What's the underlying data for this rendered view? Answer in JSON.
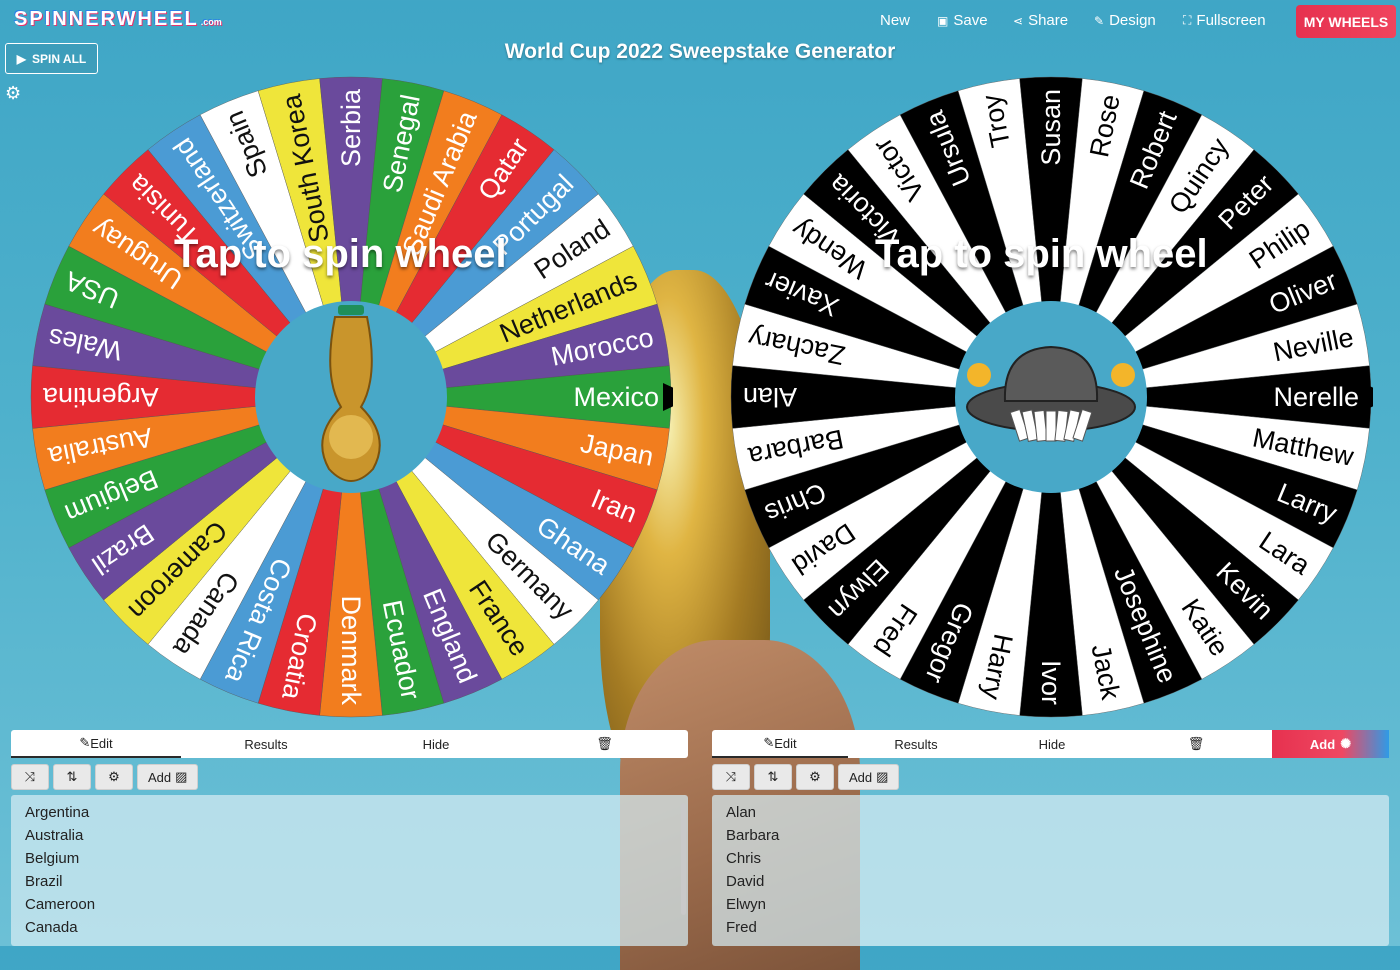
{
  "header": {
    "logo": "SPINNERWHEEL",
    "logo_suffix": ".com",
    "nav": [
      {
        "label": "New",
        "icon": ""
      },
      {
        "label": "Save",
        "icon": "save-icon"
      },
      {
        "label": "Share",
        "icon": "share-icon"
      },
      {
        "label": "Design",
        "icon": "pencil-icon"
      },
      {
        "label": "Fullscreen",
        "icon": "fullscreen-icon"
      }
    ],
    "my_wheels": "MY WHEELS",
    "title": "World Cup 2022 Sweepstake Generator",
    "spin_all": "SPIN ALL"
  },
  "wheels": [
    {
      "tap_text": "Tap to spin wheel",
      "center": "trophy-image",
      "segments": [
        {
          "label": "Mexico",
          "color": "#2aa13b"
        },
        {
          "label": "Japan",
          "color": "#f27d1e"
        },
        {
          "label": "Iran",
          "color": "#e52b32"
        },
        {
          "label": "Ghana",
          "color": "#4b9bd4"
        },
        {
          "label": "Germany",
          "color": "#ffffff"
        },
        {
          "label": "France",
          "color": "#efe53a"
        },
        {
          "label": "England",
          "color": "#6a4a9c"
        },
        {
          "label": "Ecuador",
          "color": "#2aa13b"
        },
        {
          "label": "Denmark",
          "color": "#f27d1e"
        },
        {
          "label": "Croatia",
          "color": "#e52b32"
        },
        {
          "label": "Costa Rica",
          "color": "#4b9bd4"
        },
        {
          "label": "Canada",
          "color": "#ffffff"
        },
        {
          "label": "Cameroon",
          "color": "#efe53a"
        },
        {
          "label": "Brazil",
          "color": "#6a4a9c"
        },
        {
          "label": "Belgium",
          "color": "#2aa13b"
        },
        {
          "label": "Australia",
          "color": "#f27d1e"
        },
        {
          "label": "Argentina",
          "color": "#e52b32"
        },
        {
          "label": "Wales",
          "color": "#6a4a9c"
        },
        {
          "label": "USA",
          "color": "#2aa13b"
        },
        {
          "label": "Uruguay",
          "color": "#f27d1e"
        },
        {
          "label": "Tunisia",
          "color": "#e52b32"
        },
        {
          "label": "Switzerland",
          "color": "#4b9bd4"
        },
        {
          "label": "Spain",
          "color": "#ffffff"
        },
        {
          "label": "South Korea",
          "color": "#efe53a"
        },
        {
          "label": "Serbia",
          "color": "#6a4a9c"
        },
        {
          "label": "Senegal",
          "color": "#2aa13b"
        },
        {
          "label": "Saudi Arabia",
          "color": "#f27d1e"
        },
        {
          "label": "Qatar",
          "color": "#e52b32"
        },
        {
          "label": "Portugal",
          "color": "#4b9bd4"
        },
        {
          "label": "Poland",
          "color": "#ffffff"
        },
        {
          "label": "Netherlands",
          "color": "#efe53a"
        },
        {
          "label": "Morocco",
          "color": "#6a4a9c"
        }
      ]
    },
    {
      "tap_text": "Tap to spin wheel",
      "center": "hat-image",
      "segments": [
        {
          "label": "Nerelle",
          "color": "#000000"
        },
        {
          "label": "Matthew",
          "color": "#ffffff"
        },
        {
          "label": "Larry",
          "color": "#000000"
        },
        {
          "label": "Lara",
          "color": "#ffffff"
        },
        {
          "label": "Kevin",
          "color": "#000000"
        },
        {
          "label": "Katie",
          "color": "#ffffff"
        },
        {
          "label": "Josephine",
          "color": "#000000"
        },
        {
          "label": "Jack",
          "color": "#ffffff"
        },
        {
          "label": "Ivor",
          "color": "#000000"
        },
        {
          "label": "Harry",
          "color": "#ffffff"
        },
        {
          "label": "Gregor",
          "color": "#000000"
        },
        {
          "label": "Fred",
          "color": "#ffffff"
        },
        {
          "label": "Elwyn",
          "color": "#000000"
        },
        {
          "label": "David",
          "color": "#ffffff"
        },
        {
          "label": "Chris",
          "color": "#000000"
        },
        {
          "label": "Barbara",
          "color": "#ffffff"
        },
        {
          "label": "Alan",
          "color": "#000000"
        },
        {
          "label": "Zachary",
          "color": "#ffffff"
        },
        {
          "label": "Xavier",
          "color": "#000000"
        },
        {
          "label": "Wendy",
          "color": "#ffffff"
        },
        {
          "label": "Victoria",
          "color": "#000000"
        },
        {
          "label": "Victor",
          "color": "#ffffff"
        },
        {
          "label": "Ursula",
          "color": "#000000"
        },
        {
          "label": "Troy",
          "color": "#ffffff"
        },
        {
          "label": "Susan",
          "color": "#000000"
        },
        {
          "label": "Rose",
          "color": "#ffffff"
        },
        {
          "label": "Robert",
          "color": "#000000"
        },
        {
          "label": "Quincy",
          "color": "#ffffff"
        },
        {
          "label": "Peter",
          "color": "#000000"
        },
        {
          "label": "Philip",
          "color": "#ffffff"
        },
        {
          "label": "Oliver",
          "color": "#000000"
        },
        {
          "label": "Neville",
          "color": "#ffffff"
        }
      ]
    }
  ],
  "panels": [
    {
      "tabs": [
        "Edit",
        "Results",
        "Hide"
      ],
      "tools_add": "Add",
      "items": [
        "Argentina",
        "Australia",
        "Belgium",
        "Brazil",
        "Cameroon",
        "Canada"
      ]
    },
    {
      "tabs": [
        "Edit",
        "Results",
        "Hide"
      ],
      "add_label": "Add",
      "tools_add": "Add",
      "items": [
        "Alan",
        "Barbara",
        "Chris",
        "David",
        "Elwyn",
        "Fred"
      ]
    }
  ]
}
